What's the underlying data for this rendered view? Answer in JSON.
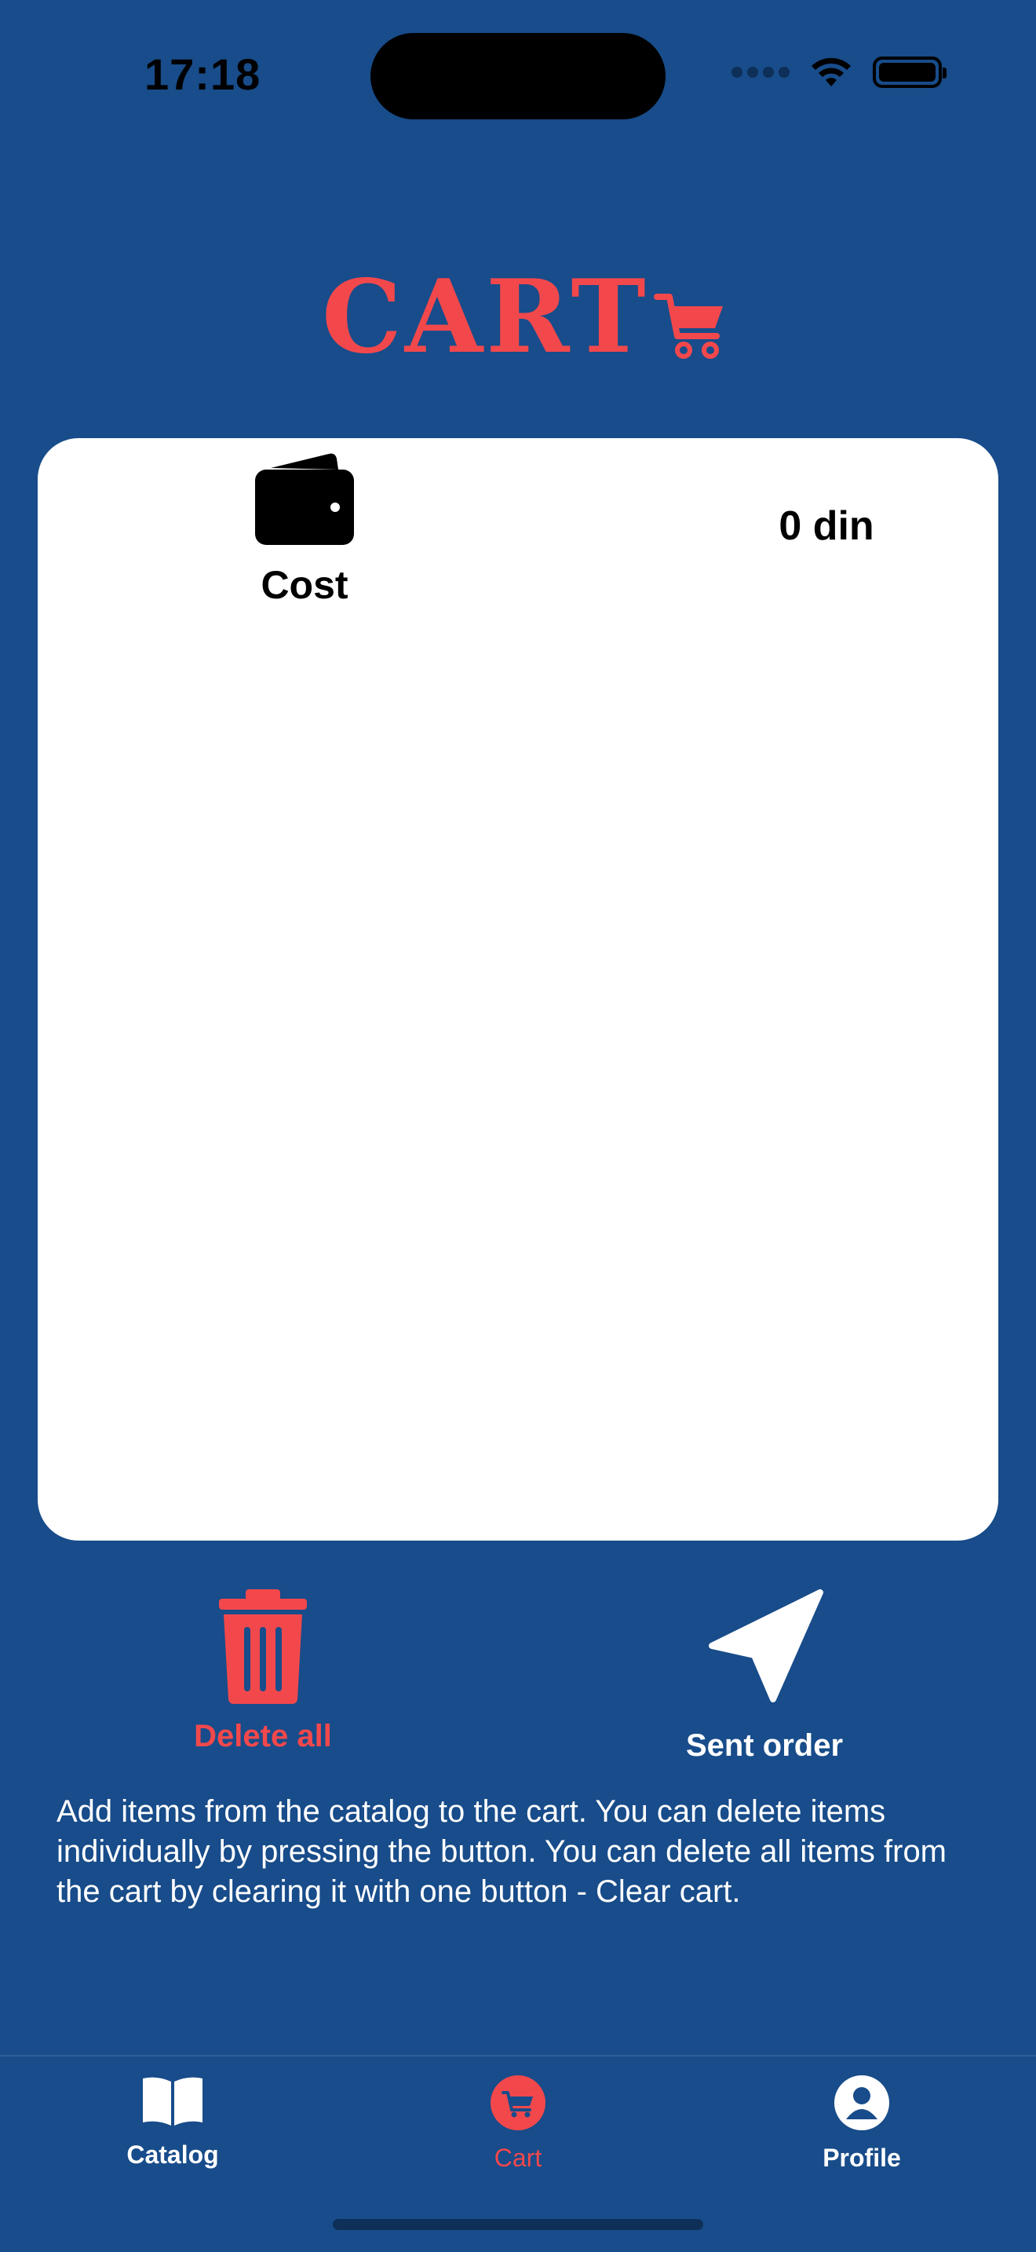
{
  "status_bar": {
    "time": "17:18"
  },
  "header": {
    "title": "CART"
  },
  "summary": {
    "cost_label": "Cost",
    "cost_value": "0 din"
  },
  "actions": {
    "delete_all_label": "Delete all",
    "send_order_label": "Sent order"
  },
  "help_text": "Add items from the catalog to the cart. You can delete items individually by pressing the button. You can delete all items from the cart by clearing it with one button - Clear cart.",
  "tab_bar": {
    "items": [
      {
        "label": "Catalog",
        "icon": "book-icon",
        "active": false
      },
      {
        "label": "Cart",
        "icon": "cart-icon",
        "active": true
      },
      {
        "label": "Profile",
        "icon": "profile-icon",
        "active": false
      }
    ]
  },
  "colors": {
    "background": "#184C8A",
    "accent": "#F2484C",
    "card": "#FFFFFF"
  }
}
